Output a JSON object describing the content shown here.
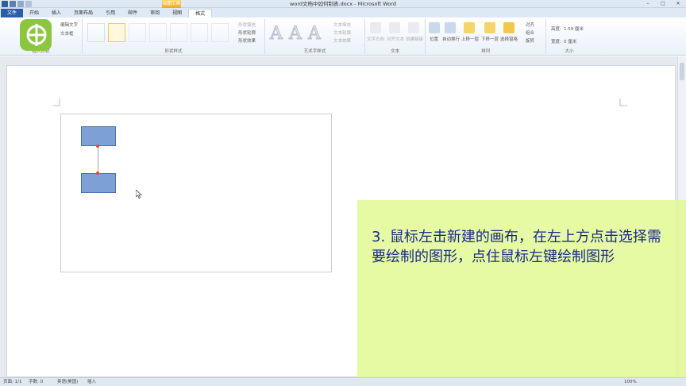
{
  "window": {
    "title": "word文档中如何制表.docx - Microsoft Word",
    "context_tab": "绘图工具",
    "controls": [
      "–",
      "□",
      "✕"
    ]
  },
  "tabs": [
    "文件",
    "开始",
    "插入",
    "页面布局",
    "引用",
    "邮件",
    "审阅",
    "视图",
    "格式"
  ],
  "ribbon": {
    "insert_shapes": {
      "label": "插入形状",
      "edit_text": "编辑文字",
      "text_box": "文本框"
    },
    "shape_styles": {
      "label": "形状样式",
      "fill": "形状填充",
      "outline": "形状轮廓",
      "effects": "形状效果"
    },
    "wordart_styles": {
      "label": "艺术字样式",
      "text_fill": "文本填充",
      "text_outline": "文本轮廓",
      "text_effects": "文本效果",
      "sample": "A"
    },
    "text": {
      "label": "文本",
      "direction": "文字方向",
      "align": "对齐文本",
      "link": "创建链接"
    },
    "arrange": {
      "label": "排列",
      "position": "位置",
      "wrap": "自动换行",
      "bring_forward": "上移一层",
      "send_backward": "下移一层",
      "selection_pane": "选择窗格",
      "align": "对齐",
      "group": "组合",
      "rotate": "旋转"
    },
    "size": {
      "label": "大小",
      "height_label": "高度:",
      "height_value": "1.59 厘米",
      "width_label": "宽度:",
      "width_value": "0 厘米"
    }
  },
  "caption": "3. 鼠标左击新建的画布，在左上方点击选择需要绘制的图形，点住鼠标左键绘制图形",
  "statusbar": {
    "page": "页面: 1/1",
    "words": "字数: 0",
    "language": "英语(美国)",
    "mode": "插入",
    "zoom": "100%"
  },
  "colors": {
    "shape_fill": "#7da1d6",
    "caption_bg": "#e2f896",
    "caption_text": "#1a2a8c",
    "file_tab": "#2a5fa8",
    "logo": "#8cc63f"
  }
}
